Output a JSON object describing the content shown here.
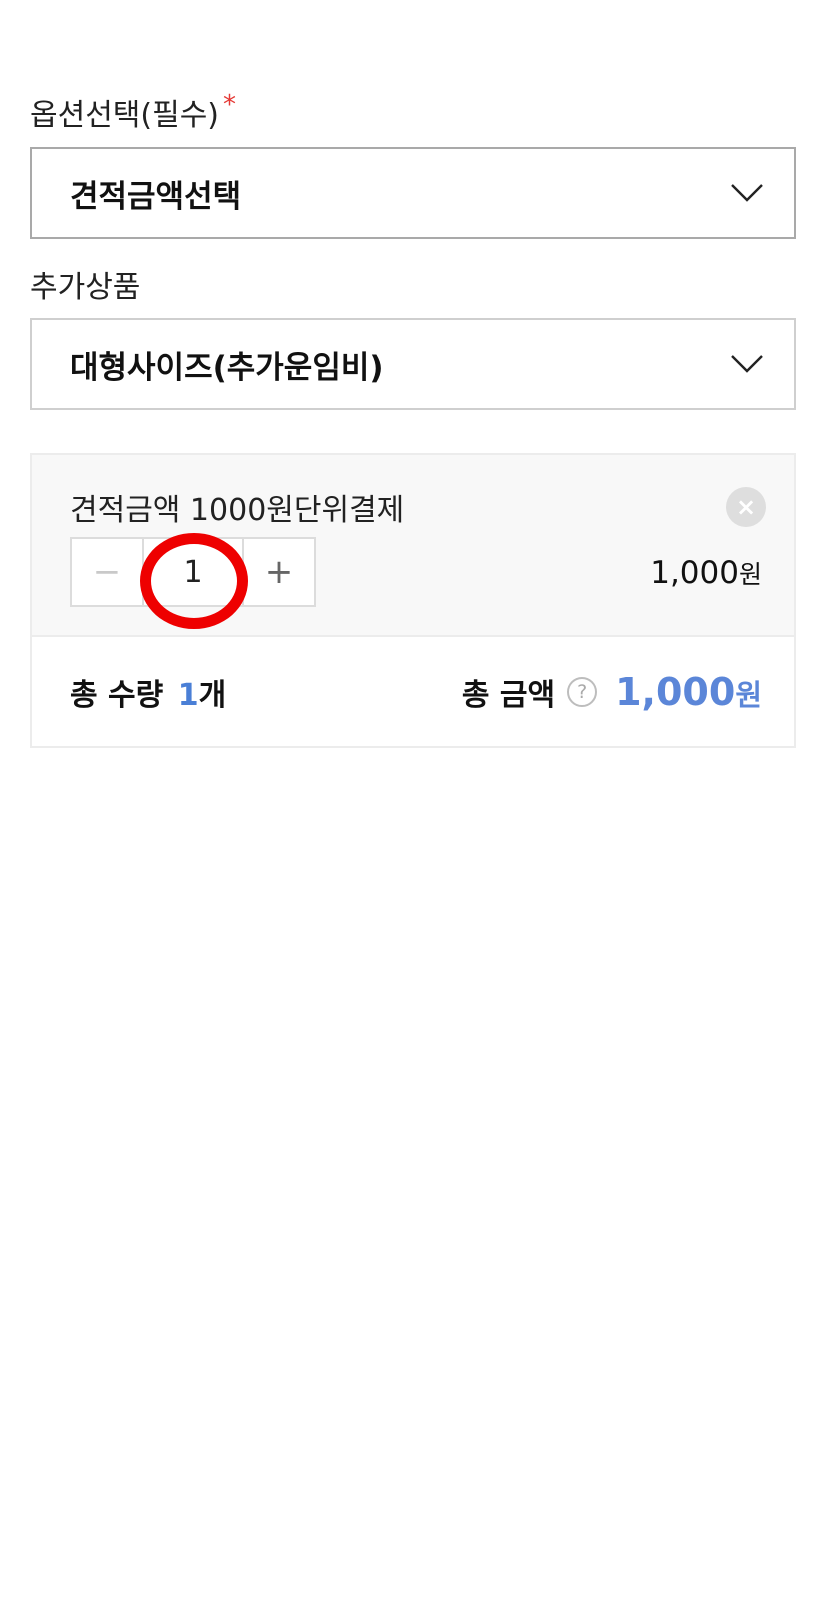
{
  "option": {
    "label": "옵션선택(필수)",
    "required_mark": "*",
    "selected": "견적금액선택"
  },
  "addon": {
    "label": "추가상품",
    "selected": "대형사이즈(추가운임비)"
  },
  "item": {
    "name": "견적금액 1000원단위결제",
    "remove_icon": "×",
    "minus": "−",
    "quantity": "1",
    "plus": "+",
    "price": "1,000",
    "price_unit": "원"
  },
  "summary": {
    "qty_label": "총 수량",
    "qty_value": "1",
    "qty_unit": "개",
    "total_label": "총 금액",
    "help_icon": "?",
    "total_value": "1,000",
    "total_unit": "원"
  },
  "colors": {
    "accent": "#5b86d8",
    "required": "#e53935",
    "highlight": "#ee0000"
  }
}
